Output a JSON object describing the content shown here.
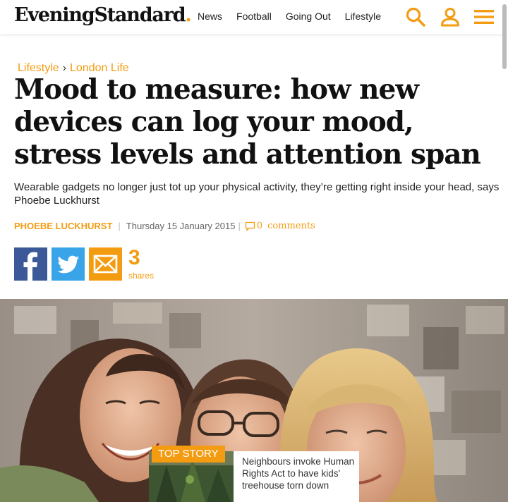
{
  "header": {
    "logo": "EveningStandard",
    "logo_dot": ".",
    "nav": [
      "News",
      "Football",
      "Going Out",
      "Lifestyle"
    ],
    "icons": [
      "search-icon",
      "account-icon",
      "menu-icon"
    ],
    "accent_color": "#f39c12"
  },
  "breadcrumb": {
    "section": "Lifestyle",
    "separator": "›",
    "subsection": "London Life"
  },
  "article": {
    "headline": "Mood to measure: how new devices can log your mood, stress levels and attention span",
    "standfirst": "Wearable gadgets no longer just tot up your physical activity, they’re getting right inside your head, says Phoebe Luckhurst",
    "author": "PHOEBE LUCKHURST",
    "date": "Thursday 15 January 2015",
    "comments_count": "0",
    "comments_label": "comments"
  },
  "share": {
    "buttons": [
      "facebook-icon",
      "twitter-icon",
      "email-icon"
    ],
    "count": "3",
    "label": "shares"
  },
  "top_story": {
    "tag": "TOP STORY",
    "headline": "Neighbours invoke Human Rights Act to have kids' treehouse torn down"
  }
}
